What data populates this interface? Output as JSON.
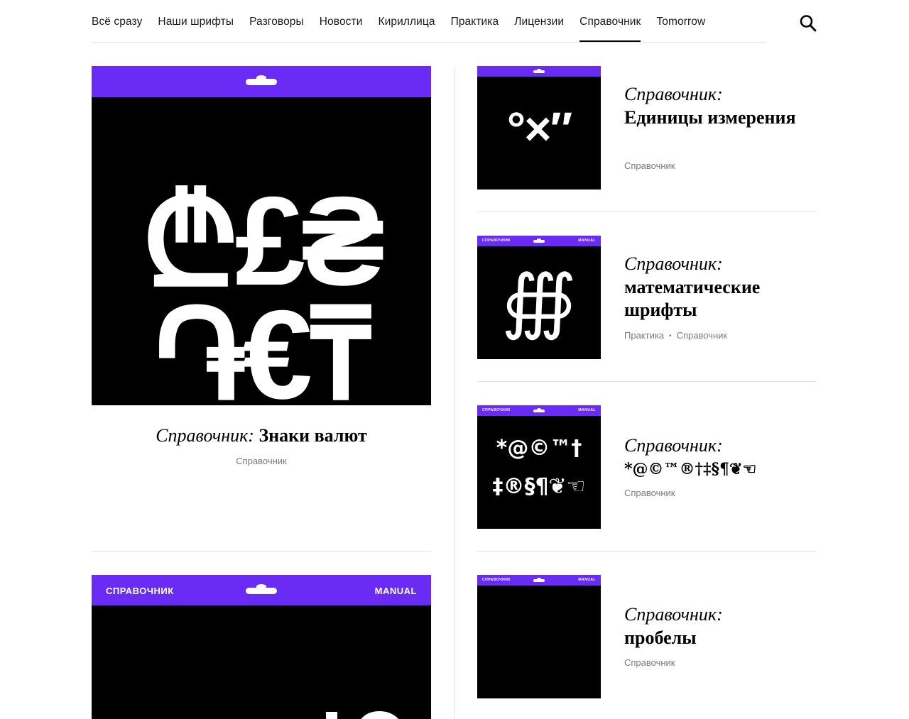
{
  "nav": {
    "items": [
      "Всё сразу",
      "Наши шрифты",
      "Разговоры",
      "Новости",
      "Кириллица",
      "Практика",
      "Лицензии",
      "Справочник",
      "Tomorrow"
    ],
    "active": "Справочник",
    "search_icon": "search-icon"
  },
  "colors": {
    "accent": "#6a2cf5",
    "cover_bg": "#000000",
    "tag": "#7a7a7a",
    "divider": "#e2e2e2"
  },
  "feature": {
    "cover_glyphs_row1": "₾£₴",
    "cover_glyphs_row2": "֏€₸",
    "title_prefix": "Справочник:",
    "title_main": "Знаки валют",
    "tag": "Справочник"
  },
  "feature2": {
    "band_left": "СПРАВОЧНИК",
    "band_right": "MANUAL"
  },
  "cards": [
    {
      "cover_symbols": "°×″",
      "band_left": "",
      "band_right": "",
      "title_prefix": "Справочник:",
      "title_main": "Единицы измерения",
      "tags": [
        "Справочник"
      ]
    },
    {
      "cover_symbols": "∰",
      "band_left": "СПРАВОЧНИК",
      "band_right": "MANUAL",
      "title_prefix": "Справочник:",
      "title_main": "математические шрифты",
      "tags": [
        "Практика",
        "Справочник"
      ]
    },
    {
      "cover_symbols_line1": "*@©™†",
      "cover_symbols_line2": "‡®§¶❦☜",
      "band_left": "СПРАВОЧНИК",
      "band_right": "MANUAL",
      "title_prefix": "Справочник:",
      "title_main": "*@©™®†‡§¶❦☜",
      "tags": [
        "Справочник"
      ]
    },
    {
      "band_left": "СПРАВОЧНИК",
      "band_right": "MANUAL",
      "title_prefix": "Справочник:",
      "title_main": "пробелы",
      "tags": [
        "Справочник"
      ]
    }
  ]
}
